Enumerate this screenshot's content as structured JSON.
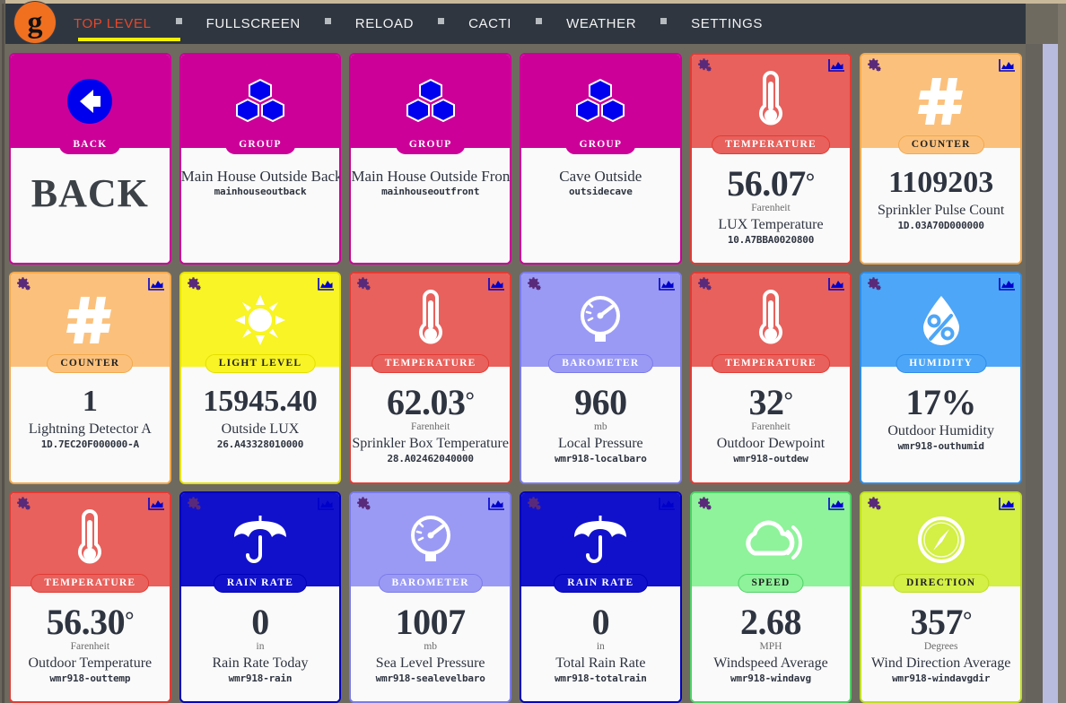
{
  "nav": {
    "logo_letter": "g",
    "items": [
      {
        "label": "TOP LEVEL",
        "active": true
      },
      {
        "label": "FULLSCREEN",
        "active": false
      },
      {
        "label": "RELOAD",
        "active": false
      },
      {
        "label": "CACTI",
        "active": false
      },
      {
        "label": "WEATHER",
        "active": false
      },
      {
        "label": "SETTINGS",
        "active": false
      }
    ],
    "separator_icon": "square-bullet-icon",
    "active_color": "#e8472a",
    "underline_color": "#f5f000",
    "bar_color": "#2f3640",
    "logo_color": "#f07020"
  },
  "scrollbar": {
    "thumb_color": "#b8bbdd",
    "track_color": "#66625c"
  },
  "cards": [
    {
      "kind": "back",
      "pill": "BACK",
      "icon": "arrow-left-circle-icon",
      "top_color": "#cc0099",
      "border_color": "#cc0099",
      "icon_color": "#0000ee",
      "pill_bg": "#cc0099",
      "pill_fg": "#ffffff",
      "word": "BACK",
      "has_gear": false,
      "has_chart": false
    },
    {
      "kind": "group",
      "pill": "GROUP",
      "icon": "cubes-icon",
      "top_color": "#cc0099",
      "border_color": "#cc0099",
      "icon_color": "#0000ee",
      "pill_bg": "#cc0099",
      "pill_fg": "#ffffff",
      "label": "Main House Outside Back",
      "sublabel": "mainhouseoutback",
      "has_gear": false,
      "has_chart": false
    },
    {
      "kind": "group",
      "pill": "GROUP",
      "icon": "cubes-icon",
      "top_color": "#cc0099",
      "border_color": "#cc0099",
      "icon_color": "#0000ee",
      "pill_bg": "#cc0099",
      "pill_fg": "#ffffff",
      "label": "Main House Outside Front",
      "sublabel": "mainhouseoutfront",
      "has_gear": false,
      "has_chart": false
    },
    {
      "kind": "group",
      "pill": "GROUP",
      "icon": "cubes-icon",
      "top_color": "#cc0099",
      "border_color": "#cc0099",
      "icon_color": "#0000ee",
      "pill_bg": "#cc0099",
      "pill_fg": "#ffffff",
      "label": "Cave Outside",
      "sublabel": "outsidecave",
      "has_gear": false,
      "has_chart": false
    },
    {
      "kind": "sensor",
      "pill": "TEMPERATURE",
      "icon": "thermometer-icon",
      "top_color": "#e8615c",
      "border_color": "#e23b34",
      "icon_color": "#ffffff",
      "pill_bg": "#e8615c",
      "pill_fg": "#ffffff",
      "value": "56.07",
      "degree": true,
      "unit": "Farenheit",
      "label": "LUX Temperature",
      "sublabel": "10.A7BBA0020800",
      "has_gear": true,
      "has_chart": true
    },
    {
      "kind": "sensor",
      "pill": "COUNTER",
      "icon": "hash-icon",
      "top_color": "#fbc17c",
      "border_color": "#f3a94e",
      "icon_color": "#ffffff",
      "pill_bg": "#fbc17c",
      "pill_fg": "#222222",
      "value": "1109203",
      "degree": false,
      "unit": "",
      "label": "Sprinkler Pulse Count",
      "sublabel": "1D.03A70D000000",
      "small_value": true,
      "has_gear": true,
      "has_chart": true
    },
    {
      "kind": "sensor",
      "pill": "COUNTER",
      "icon": "hash-icon",
      "top_color": "#fbc17c",
      "border_color": "#f3a94e",
      "icon_color": "#ffffff",
      "pill_bg": "#fbc17c",
      "pill_fg": "#222222",
      "value": "1",
      "degree": false,
      "unit": "",
      "label": "Lightning Detector A",
      "sublabel": "1D.7EC20F000000-A",
      "small_value": true,
      "has_gear": true,
      "has_chart": true
    },
    {
      "kind": "sensor",
      "pill": "LIGHT LEVEL",
      "icon": "sun-icon",
      "top_color": "#f8f425",
      "border_color": "#e5e000",
      "icon_color": "#ffffff",
      "pill_bg": "#f8f425",
      "pill_fg": "#222222",
      "value": "15945.40",
      "degree": false,
      "unit": "",
      "label": "Outside LUX",
      "sublabel": "26.A43328010000",
      "small_value": true,
      "has_gear": true,
      "has_chart": true
    },
    {
      "kind": "sensor",
      "pill": "TEMPERATURE",
      "icon": "thermometer-icon",
      "top_color": "#e8615c",
      "border_color": "#e23b34",
      "icon_color": "#ffffff",
      "pill_bg": "#e8615c",
      "pill_fg": "#ffffff",
      "value": "62.03",
      "degree": true,
      "unit": "Farenheit",
      "label": "Sprinkler Box Temperature",
      "sublabel": "28.A02462040000",
      "has_gear": true,
      "has_chart": true
    },
    {
      "kind": "sensor",
      "pill": "BAROMETER",
      "icon": "gauge-icon",
      "top_color": "#9a9af5",
      "border_color": "#7b7bea",
      "icon_color": "#ffffff",
      "pill_bg": "#9a9af5",
      "pill_fg": "#ffffff",
      "value": "960",
      "degree": false,
      "unit": "mb",
      "label": "Local Pressure",
      "sublabel": "wmr918-localbaro",
      "has_gear": true,
      "has_chart": true
    },
    {
      "kind": "sensor",
      "pill": "TEMPERATURE",
      "icon": "thermometer-icon",
      "top_color": "#e8615c",
      "border_color": "#e23b34",
      "icon_color": "#ffffff",
      "pill_bg": "#e8615c",
      "pill_fg": "#ffffff",
      "value": "32",
      "degree": true,
      "unit": "Farenheit",
      "label": "Outdoor Dewpoint",
      "sublabel": "wmr918-outdew",
      "has_gear": true,
      "has_chart": true
    },
    {
      "kind": "sensor",
      "pill": "HUMIDITY",
      "icon": "humidity-drop-icon",
      "top_color": "#4da6f7",
      "border_color": "#2f8de8",
      "icon_color": "#ffffff",
      "pill_bg": "#4da6f7",
      "pill_fg": "#ffffff",
      "value": "17%",
      "degree": false,
      "unit": "",
      "label": "Outdoor Humidity",
      "sublabel": "wmr918-outhumid",
      "has_gear": true,
      "has_chart": true
    },
    {
      "kind": "sensor",
      "pill": "TEMPERATURE",
      "icon": "thermometer-icon",
      "top_color": "#e8615c",
      "border_color": "#e23b34",
      "icon_color": "#ffffff",
      "pill_bg": "#e8615c",
      "pill_fg": "#ffffff",
      "value": "56.30",
      "degree": true,
      "unit": "Farenheit",
      "label": "Outdoor Temperature",
      "sublabel": "wmr918-outtemp",
      "has_gear": true,
      "has_chart": true
    },
    {
      "kind": "sensor",
      "pill": "RAIN RATE",
      "icon": "umbrella-icon",
      "top_color": "#1111cc",
      "border_color": "#0000bb",
      "icon_color": "#ffffff",
      "pill_bg": "#1111cc",
      "pill_fg": "#ffffff",
      "value": "0",
      "degree": false,
      "unit": "in",
      "label": "Rain Rate Today",
      "sublabel": "wmr918-rain",
      "has_gear": true,
      "has_chart": true
    },
    {
      "kind": "sensor",
      "pill": "BAROMETER",
      "icon": "gauge-icon",
      "top_color": "#9a9af5",
      "border_color": "#7b7bea",
      "icon_color": "#ffffff",
      "pill_bg": "#9a9af5",
      "pill_fg": "#ffffff",
      "value": "1007",
      "degree": false,
      "unit": "mb",
      "label": "Sea Level Pressure",
      "sublabel": "wmr918-sealevelbaro",
      "has_gear": true,
      "has_chart": true
    },
    {
      "kind": "sensor",
      "pill": "RAIN RATE",
      "icon": "umbrella-icon",
      "top_color": "#1111cc",
      "border_color": "#0000bb",
      "icon_color": "#ffffff",
      "pill_bg": "#1111cc",
      "pill_fg": "#ffffff",
      "value": "0",
      "degree": false,
      "unit": "in",
      "label": "Total Rain Rate",
      "sublabel": "wmr918-totalrain",
      "has_gear": true,
      "has_chart": true
    },
    {
      "kind": "sensor",
      "pill": "SPEED",
      "icon": "wind-cloud-icon",
      "top_color": "#8ef39a",
      "border_color": "#4fd267",
      "icon_color": "#ffffff",
      "pill_bg": "#8ef39a",
      "pill_fg": "#222222",
      "value": "2.68",
      "degree": false,
      "unit": "MPH",
      "label": "Windspeed Average",
      "sublabel": "wmr918-windavg",
      "has_gear": true,
      "has_chart": true
    },
    {
      "kind": "sensor",
      "pill": "DIRECTION",
      "icon": "compass-icon",
      "top_color": "#d4ef45",
      "border_color": "#bede21",
      "icon_color": "#ffffff",
      "pill_bg": "#d4ef45",
      "pill_fg": "#222222",
      "value": "357",
      "degree": true,
      "unit": "Degrees",
      "label": "Wind Direction Average",
      "sublabel": "wmr918-windavgdir",
      "has_gear": true,
      "has_chart": true
    }
  ]
}
